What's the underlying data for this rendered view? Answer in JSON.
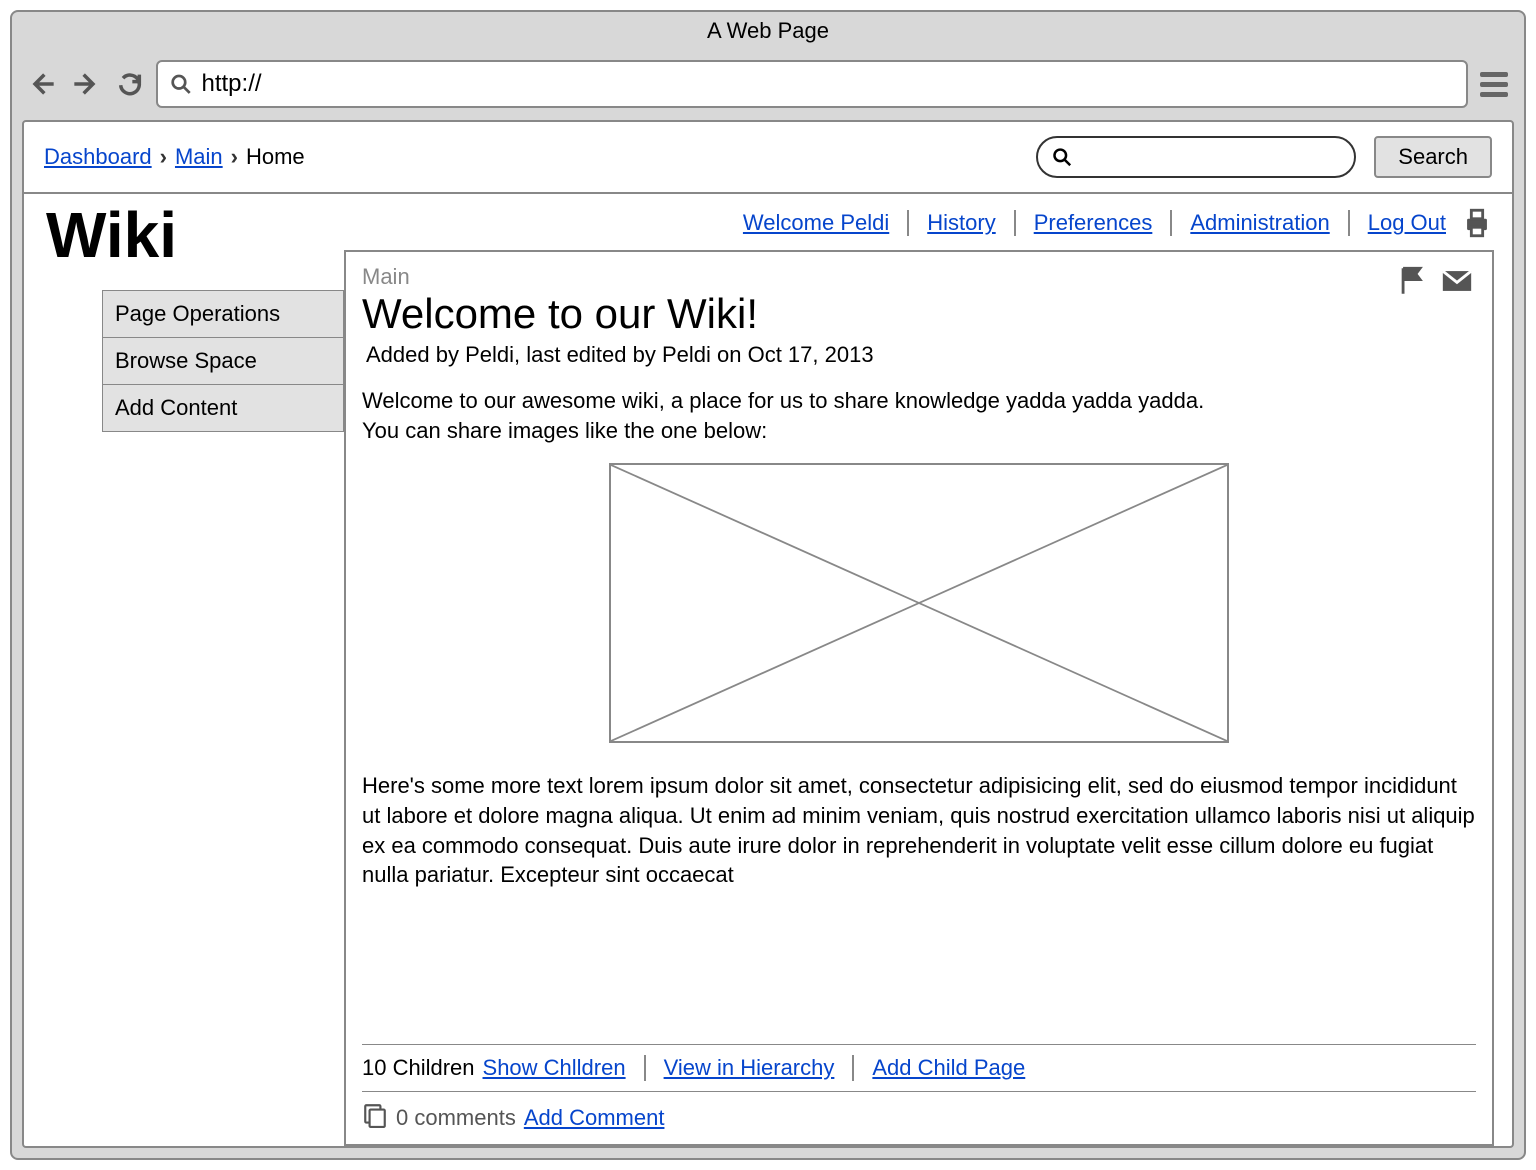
{
  "browser": {
    "title": "A Web Page",
    "url": "http://"
  },
  "breadcrumb": {
    "items": [
      {
        "label": "Dashboard",
        "link": true
      },
      {
        "label": "Main",
        "link": true
      },
      {
        "label": "Home",
        "link": false
      }
    ]
  },
  "search": {
    "button_label": "Search"
  },
  "site": {
    "title": "Wiki"
  },
  "sidebar": {
    "items": [
      "Page Operations",
      "Browse Space",
      "Add Content"
    ]
  },
  "utility_links": [
    "Welcome Peldi",
    "History",
    "Preferences",
    "Administration",
    "Log Out"
  ],
  "article": {
    "space": "Main",
    "title": "Welcome to our Wiki!",
    "byline": "Added by Peldi, last edited by Peldi on Oct 17, 2013",
    "intro1": "Welcome to our awesome wiki, a place for us to share knowledge yadda yadda yadda.",
    "intro2": "You can share images like the one below:",
    "lorem": "Here's some more text lorem ipsum dolor sit amet, consectetur adipisicing elit, sed do eiusmod tempor incididunt ut labore et dolore magna aliqua. Ut enim ad minim veniam, quis nostrud exercitation ullamco laboris nisi ut aliquip ex ea commodo consequat. Duis aute irure dolor in reprehenderit in voluptate velit esse cillum dolore eu fugiat nulla pariatur. Excepteur sint occaecat"
  },
  "children": {
    "count_label": "10 Children",
    "links": [
      "Show Chlldren",
      "View in Hierarchy",
      "Add Child Page"
    ]
  },
  "comments": {
    "count_label": "0 comments",
    "add_label": "Add Comment"
  }
}
